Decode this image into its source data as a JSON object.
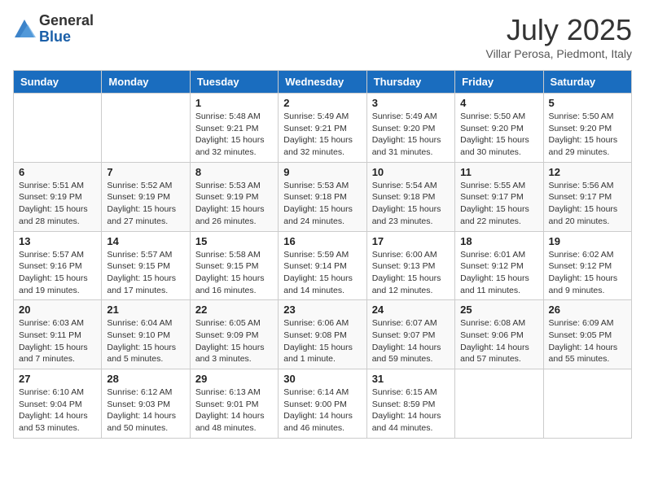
{
  "logo": {
    "general": "General",
    "blue": "Blue"
  },
  "title": {
    "month": "July 2025",
    "location": "Villar Perosa, Piedmont, Italy"
  },
  "days_of_week": [
    "Sunday",
    "Monday",
    "Tuesday",
    "Wednesday",
    "Thursday",
    "Friday",
    "Saturday"
  ],
  "weeks": [
    [
      null,
      null,
      {
        "day": "1",
        "sunrise": "Sunrise: 5:48 AM",
        "sunset": "Sunset: 9:21 PM",
        "daylight": "Daylight: 15 hours and 32 minutes."
      },
      {
        "day": "2",
        "sunrise": "Sunrise: 5:49 AM",
        "sunset": "Sunset: 9:21 PM",
        "daylight": "Daylight: 15 hours and 32 minutes."
      },
      {
        "day": "3",
        "sunrise": "Sunrise: 5:49 AM",
        "sunset": "Sunset: 9:20 PM",
        "daylight": "Daylight: 15 hours and 31 minutes."
      },
      {
        "day": "4",
        "sunrise": "Sunrise: 5:50 AM",
        "sunset": "Sunset: 9:20 PM",
        "daylight": "Daylight: 15 hours and 30 minutes."
      },
      {
        "day": "5",
        "sunrise": "Sunrise: 5:50 AM",
        "sunset": "Sunset: 9:20 PM",
        "daylight": "Daylight: 15 hours and 29 minutes."
      }
    ],
    [
      {
        "day": "6",
        "sunrise": "Sunrise: 5:51 AM",
        "sunset": "Sunset: 9:19 PM",
        "daylight": "Daylight: 15 hours and 28 minutes."
      },
      {
        "day": "7",
        "sunrise": "Sunrise: 5:52 AM",
        "sunset": "Sunset: 9:19 PM",
        "daylight": "Daylight: 15 hours and 27 minutes."
      },
      {
        "day": "8",
        "sunrise": "Sunrise: 5:53 AM",
        "sunset": "Sunset: 9:19 PM",
        "daylight": "Daylight: 15 hours and 26 minutes."
      },
      {
        "day": "9",
        "sunrise": "Sunrise: 5:53 AM",
        "sunset": "Sunset: 9:18 PM",
        "daylight": "Daylight: 15 hours and 24 minutes."
      },
      {
        "day": "10",
        "sunrise": "Sunrise: 5:54 AM",
        "sunset": "Sunset: 9:18 PM",
        "daylight": "Daylight: 15 hours and 23 minutes."
      },
      {
        "day": "11",
        "sunrise": "Sunrise: 5:55 AM",
        "sunset": "Sunset: 9:17 PM",
        "daylight": "Daylight: 15 hours and 22 minutes."
      },
      {
        "day": "12",
        "sunrise": "Sunrise: 5:56 AM",
        "sunset": "Sunset: 9:17 PM",
        "daylight": "Daylight: 15 hours and 20 minutes."
      }
    ],
    [
      {
        "day": "13",
        "sunrise": "Sunrise: 5:57 AM",
        "sunset": "Sunset: 9:16 PM",
        "daylight": "Daylight: 15 hours and 19 minutes."
      },
      {
        "day": "14",
        "sunrise": "Sunrise: 5:57 AM",
        "sunset": "Sunset: 9:15 PM",
        "daylight": "Daylight: 15 hours and 17 minutes."
      },
      {
        "day": "15",
        "sunrise": "Sunrise: 5:58 AM",
        "sunset": "Sunset: 9:15 PM",
        "daylight": "Daylight: 15 hours and 16 minutes."
      },
      {
        "day": "16",
        "sunrise": "Sunrise: 5:59 AM",
        "sunset": "Sunset: 9:14 PM",
        "daylight": "Daylight: 15 hours and 14 minutes."
      },
      {
        "day": "17",
        "sunrise": "Sunrise: 6:00 AM",
        "sunset": "Sunset: 9:13 PM",
        "daylight": "Daylight: 15 hours and 12 minutes."
      },
      {
        "day": "18",
        "sunrise": "Sunrise: 6:01 AM",
        "sunset": "Sunset: 9:12 PM",
        "daylight": "Daylight: 15 hours and 11 minutes."
      },
      {
        "day": "19",
        "sunrise": "Sunrise: 6:02 AM",
        "sunset": "Sunset: 9:12 PM",
        "daylight": "Daylight: 15 hours and 9 minutes."
      }
    ],
    [
      {
        "day": "20",
        "sunrise": "Sunrise: 6:03 AM",
        "sunset": "Sunset: 9:11 PM",
        "daylight": "Daylight: 15 hours and 7 minutes."
      },
      {
        "day": "21",
        "sunrise": "Sunrise: 6:04 AM",
        "sunset": "Sunset: 9:10 PM",
        "daylight": "Daylight: 15 hours and 5 minutes."
      },
      {
        "day": "22",
        "sunrise": "Sunrise: 6:05 AM",
        "sunset": "Sunset: 9:09 PM",
        "daylight": "Daylight: 15 hours and 3 minutes."
      },
      {
        "day": "23",
        "sunrise": "Sunrise: 6:06 AM",
        "sunset": "Sunset: 9:08 PM",
        "daylight": "Daylight: 15 hours and 1 minute."
      },
      {
        "day": "24",
        "sunrise": "Sunrise: 6:07 AM",
        "sunset": "Sunset: 9:07 PM",
        "daylight": "Daylight: 14 hours and 59 minutes."
      },
      {
        "day": "25",
        "sunrise": "Sunrise: 6:08 AM",
        "sunset": "Sunset: 9:06 PM",
        "daylight": "Daylight: 14 hours and 57 minutes."
      },
      {
        "day": "26",
        "sunrise": "Sunrise: 6:09 AM",
        "sunset": "Sunset: 9:05 PM",
        "daylight": "Daylight: 14 hours and 55 minutes."
      }
    ],
    [
      {
        "day": "27",
        "sunrise": "Sunrise: 6:10 AM",
        "sunset": "Sunset: 9:04 PM",
        "daylight": "Daylight: 14 hours and 53 minutes."
      },
      {
        "day": "28",
        "sunrise": "Sunrise: 6:12 AM",
        "sunset": "Sunset: 9:03 PM",
        "daylight": "Daylight: 14 hours and 50 minutes."
      },
      {
        "day": "29",
        "sunrise": "Sunrise: 6:13 AM",
        "sunset": "Sunset: 9:01 PM",
        "daylight": "Daylight: 14 hours and 48 minutes."
      },
      {
        "day": "30",
        "sunrise": "Sunrise: 6:14 AM",
        "sunset": "Sunset: 9:00 PM",
        "daylight": "Daylight: 14 hours and 46 minutes."
      },
      {
        "day": "31",
        "sunrise": "Sunrise: 6:15 AM",
        "sunset": "Sunset: 8:59 PM",
        "daylight": "Daylight: 14 hours and 44 minutes."
      },
      null,
      null
    ]
  ]
}
